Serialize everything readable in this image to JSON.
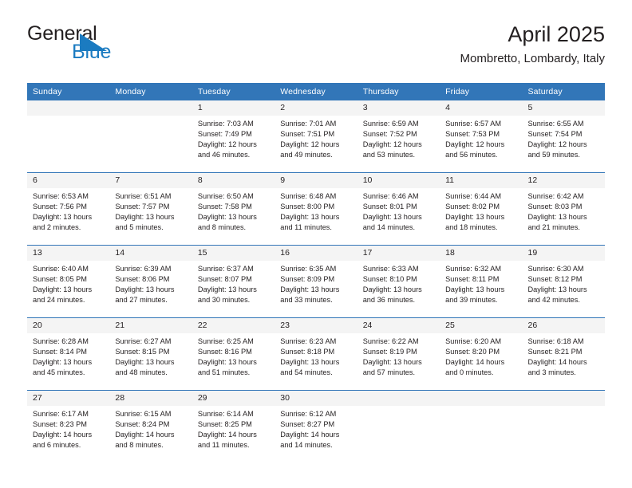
{
  "brand": {
    "name_part1": "General",
    "name_part2": "Blue",
    "flag_color": "#1b7bc1",
    "text_color": "#231f20"
  },
  "header": {
    "title": "April 2025",
    "subtitle": "Mombretto, Lombardy, Italy"
  },
  "theme": {
    "header_blue": "#3276b8",
    "daynum_band": "#f4f4f4",
    "text": "#231f20",
    "page_background": "#ffffff"
  },
  "calendar": {
    "month": "April",
    "year": "2025",
    "location": "Mombretto, Lombardy, Italy",
    "weekday_headers": [
      "Sunday",
      "Monday",
      "Tuesday",
      "Wednesday",
      "Thursday",
      "Friday",
      "Saturday"
    ],
    "labels": {
      "sunrise_prefix": "Sunrise:",
      "sunset_prefix": "Sunset:",
      "daylight_prefix": "Daylight:"
    },
    "weeks": [
      [
        {
          "day": "",
          "empty": true,
          "line1": "",
          "line2": "",
          "line3": "",
          "line4": ""
        },
        {
          "day": "",
          "empty": true,
          "line1": "",
          "line2": "",
          "line3": "",
          "line4": ""
        },
        {
          "day": "1",
          "empty": false,
          "line1": "Sunrise: 7:03 AM",
          "line2": "Sunset: 7:49 PM",
          "line3": "Daylight: 12 hours",
          "line4": "and 46 minutes."
        },
        {
          "day": "2",
          "empty": false,
          "line1": "Sunrise: 7:01 AM",
          "line2": "Sunset: 7:51 PM",
          "line3": "Daylight: 12 hours",
          "line4": "and 49 minutes."
        },
        {
          "day": "3",
          "empty": false,
          "line1": "Sunrise: 6:59 AM",
          "line2": "Sunset: 7:52 PM",
          "line3": "Daylight: 12 hours",
          "line4": "and 53 minutes."
        },
        {
          "day": "4",
          "empty": false,
          "line1": "Sunrise: 6:57 AM",
          "line2": "Sunset: 7:53 PM",
          "line3": "Daylight: 12 hours",
          "line4": "and 56 minutes."
        },
        {
          "day": "5",
          "empty": false,
          "line1": "Sunrise: 6:55 AM",
          "line2": "Sunset: 7:54 PM",
          "line3": "Daylight: 12 hours",
          "line4": "and 59 minutes."
        }
      ],
      [
        {
          "day": "6",
          "empty": false,
          "line1": "Sunrise: 6:53 AM",
          "line2": "Sunset: 7:56 PM",
          "line3": "Daylight: 13 hours",
          "line4": "and 2 minutes."
        },
        {
          "day": "7",
          "empty": false,
          "line1": "Sunrise: 6:51 AM",
          "line2": "Sunset: 7:57 PM",
          "line3": "Daylight: 13 hours",
          "line4": "and 5 minutes."
        },
        {
          "day": "8",
          "empty": false,
          "line1": "Sunrise: 6:50 AM",
          "line2": "Sunset: 7:58 PM",
          "line3": "Daylight: 13 hours",
          "line4": "and 8 minutes."
        },
        {
          "day": "9",
          "empty": false,
          "line1": "Sunrise: 6:48 AM",
          "line2": "Sunset: 8:00 PM",
          "line3": "Daylight: 13 hours",
          "line4": "and 11 minutes."
        },
        {
          "day": "10",
          "empty": false,
          "line1": "Sunrise: 6:46 AM",
          "line2": "Sunset: 8:01 PM",
          "line3": "Daylight: 13 hours",
          "line4": "and 14 minutes."
        },
        {
          "day": "11",
          "empty": false,
          "line1": "Sunrise: 6:44 AM",
          "line2": "Sunset: 8:02 PM",
          "line3": "Daylight: 13 hours",
          "line4": "and 18 minutes."
        },
        {
          "day": "12",
          "empty": false,
          "line1": "Sunrise: 6:42 AM",
          "line2": "Sunset: 8:03 PM",
          "line3": "Daylight: 13 hours",
          "line4": "and 21 minutes."
        }
      ],
      [
        {
          "day": "13",
          "empty": false,
          "line1": "Sunrise: 6:40 AM",
          "line2": "Sunset: 8:05 PM",
          "line3": "Daylight: 13 hours",
          "line4": "and 24 minutes."
        },
        {
          "day": "14",
          "empty": false,
          "line1": "Sunrise: 6:39 AM",
          "line2": "Sunset: 8:06 PM",
          "line3": "Daylight: 13 hours",
          "line4": "and 27 minutes."
        },
        {
          "day": "15",
          "empty": false,
          "line1": "Sunrise: 6:37 AM",
          "line2": "Sunset: 8:07 PM",
          "line3": "Daylight: 13 hours",
          "line4": "and 30 minutes."
        },
        {
          "day": "16",
          "empty": false,
          "line1": "Sunrise: 6:35 AM",
          "line2": "Sunset: 8:09 PM",
          "line3": "Daylight: 13 hours",
          "line4": "and 33 minutes."
        },
        {
          "day": "17",
          "empty": false,
          "line1": "Sunrise: 6:33 AM",
          "line2": "Sunset: 8:10 PM",
          "line3": "Daylight: 13 hours",
          "line4": "and 36 minutes."
        },
        {
          "day": "18",
          "empty": false,
          "line1": "Sunrise: 6:32 AM",
          "line2": "Sunset: 8:11 PM",
          "line3": "Daylight: 13 hours",
          "line4": "and 39 minutes."
        },
        {
          "day": "19",
          "empty": false,
          "line1": "Sunrise: 6:30 AM",
          "line2": "Sunset: 8:12 PM",
          "line3": "Daylight: 13 hours",
          "line4": "and 42 minutes."
        }
      ],
      [
        {
          "day": "20",
          "empty": false,
          "line1": "Sunrise: 6:28 AM",
          "line2": "Sunset: 8:14 PM",
          "line3": "Daylight: 13 hours",
          "line4": "and 45 minutes."
        },
        {
          "day": "21",
          "empty": false,
          "line1": "Sunrise: 6:27 AM",
          "line2": "Sunset: 8:15 PM",
          "line3": "Daylight: 13 hours",
          "line4": "and 48 minutes."
        },
        {
          "day": "22",
          "empty": false,
          "line1": "Sunrise: 6:25 AM",
          "line2": "Sunset: 8:16 PM",
          "line3": "Daylight: 13 hours",
          "line4": "and 51 minutes."
        },
        {
          "day": "23",
          "empty": false,
          "line1": "Sunrise: 6:23 AM",
          "line2": "Sunset: 8:18 PM",
          "line3": "Daylight: 13 hours",
          "line4": "and 54 minutes."
        },
        {
          "day": "24",
          "empty": false,
          "line1": "Sunrise: 6:22 AM",
          "line2": "Sunset: 8:19 PM",
          "line3": "Daylight: 13 hours",
          "line4": "and 57 minutes."
        },
        {
          "day": "25",
          "empty": false,
          "line1": "Sunrise: 6:20 AM",
          "line2": "Sunset: 8:20 PM",
          "line3": "Daylight: 14 hours",
          "line4": "and 0 minutes."
        },
        {
          "day": "26",
          "empty": false,
          "line1": "Sunrise: 6:18 AM",
          "line2": "Sunset: 8:21 PM",
          "line3": "Daylight: 14 hours",
          "line4": "and 3 minutes."
        }
      ],
      [
        {
          "day": "27",
          "empty": false,
          "line1": "Sunrise: 6:17 AM",
          "line2": "Sunset: 8:23 PM",
          "line3": "Daylight: 14 hours",
          "line4": "and 6 minutes."
        },
        {
          "day": "28",
          "empty": false,
          "line1": "Sunrise: 6:15 AM",
          "line2": "Sunset: 8:24 PM",
          "line3": "Daylight: 14 hours",
          "line4": "and 8 minutes."
        },
        {
          "day": "29",
          "empty": false,
          "line1": "Sunrise: 6:14 AM",
          "line2": "Sunset: 8:25 PM",
          "line3": "Daylight: 14 hours",
          "line4": "and 11 minutes."
        },
        {
          "day": "30",
          "empty": false,
          "line1": "Sunrise: 6:12 AM",
          "line2": "Sunset: 8:27 PM",
          "line3": "Daylight: 14 hours",
          "line4": "and 14 minutes."
        },
        {
          "day": "",
          "empty": true,
          "line1": "",
          "line2": "",
          "line3": "",
          "line4": ""
        },
        {
          "day": "",
          "empty": true,
          "line1": "",
          "line2": "",
          "line3": "",
          "line4": ""
        },
        {
          "day": "",
          "empty": true,
          "line1": "",
          "line2": "",
          "line3": "",
          "line4": ""
        }
      ]
    ]
  }
}
